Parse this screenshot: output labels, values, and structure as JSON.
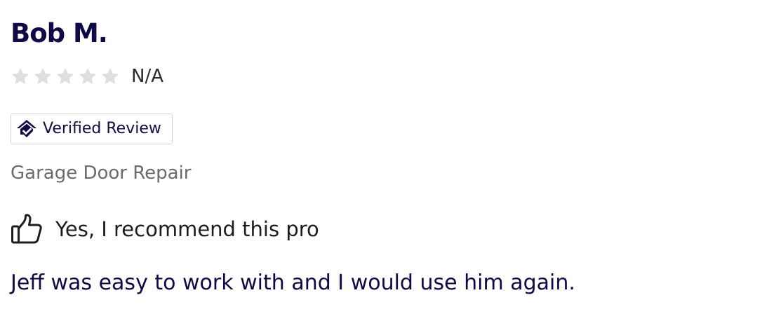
{
  "review": {
    "reviewer_name": "Bob M.",
    "rating": {
      "stars_total": 5,
      "stars_filled": 0,
      "value_text": "N/A",
      "star_color": "#dedede"
    },
    "verified_badge": {
      "label": "Verified Review",
      "icon": "house-check-icon",
      "border_color": "#cfcfd4"
    },
    "service": "Garage Door Repair",
    "recommendation": {
      "icon": "thumbs-up-icon",
      "label": "Yes, I recommend this pro"
    },
    "text": "Jeff was easy to work with and I would use him again."
  },
  "colors": {
    "brand_navy": "#0f0a45",
    "muted_gray": "#6b6b6b",
    "body_text": "#1d1d1d"
  }
}
